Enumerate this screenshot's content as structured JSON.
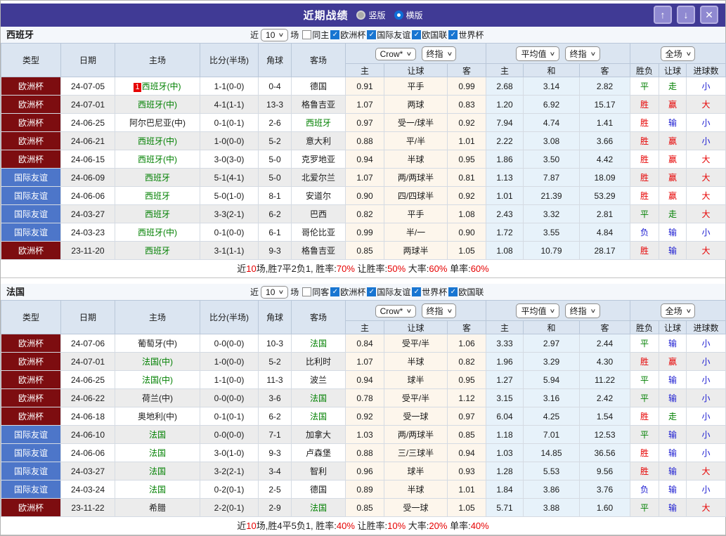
{
  "window": {
    "title": "近期战绩",
    "radios": [
      {
        "label": "竖版",
        "selected": false
      },
      {
        "label": "横版",
        "selected": true
      }
    ],
    "up": "↑",
    "down": "↓",
    "close": "✕"
  },
  "icons": {
    "check": "✓",
    "chevron": "∨"
  },
  "colors": {
    "titlebar": "#403a95",
    "type_cup": "#7d0d10",
    "type_friendly": "#4d76c9",
    "win_red": "#e60000",
    "draw_green": "#008000",
    "lose_blue": "#1b1bd1",
    "handicap_bg": "#fdf6ec",
    "average_bg": "#e7f2fa",
    "header_bg": "#dbe5f1"
  },
  "columns": {
    "left": [
      "类型",
      "日期",
      "主场",
      "比分(半场)",
      "角球",
      "客场"
    ],
    "odds_sub": [
      "主",
      "让球",
      "客"
    ],
    "avg_sub": [
      "主",
      "和",
      "客"
    ],
    "result_sub": [
      "胜负",
      "让球",
      "进球数"
    ]
  },
  "sections": [
    {
      "team": "西班牙",
      "filter": {
        "near": "近",
        "count": "10",
        "unit": "场",
        "same": "同主",
        "leagues": [
          "欧洲杯",
          "国际友谊",
          "欧国联",
          "世界杯"
        ]
      },
      "dropdowns": {
        "odds": "Crow*",
        "odds_time": "终指",
        "avg": "平均值",
        "avg_time": "终指",
        "scope": "全场"
      },
      "rows": [
        {
          "type": "欧洲杯",
          "style": "cup",
          "date": "24-07-05",
          "badge": "1",
          "home": "西班牙(中)",
          "home_hl": true,
          "score": "1-1(0-0)",
          "corner": "0-4",
          "away": "德国",
          "away_hl": false,
          "odds": [
            "0.91",
            "平手",
            "0.99"
          ],
          "avg": [
            "2.68",
            "3.14",
            "2.82"
          ],
          "results": [
            [
              "平",
              "g"
            ],
            [
              "走",
              "g"
            ],
            [
              "小",
              "b"
            ]
          ]
        },
        {
          "type": "欧洲杯",
          "style": "cup",
          "date": "24-07-01",
          "home": "西班牙(中)",
          "home_hl": true,
          "score": "4-1(1-1)",
          "corner": "13-3",
          "away": "格鲁吉亚",
          "away_hl": false,
          "odds": [
            "1.07",
            "两球",
            "0.83"
          ],
          "avg": [
            "1.20",
            "6.92",
            "15.17"
          ],
          "results": [
            [
              "胜",
              "r"
            ],
            [
              "赢",
              "r"
            ],
            [
              "大",
              "r"
            ]
          ]
        },
        {
          "type": "欧洲杯",
          "style": "cup",
          "date": "24-06-25",
          "home": "阿尔巴尼亚(中)",
          "home_hl": false,
          "score": "0-1(0-1)",
          "corner": "2-6",
          "away": "西班牙",
          "away_hl": true,
          "odds": [
            "0.97",
            "受一/球半",
            "0.92"
          ],
          "avg": [
            "7.94",
            "4.74",
            "1.41"
          ],
          "results": [
            [
              "胜",
              "r"
            ],
            [
              "输",
              "b"
            ],
            [
              "小",
              "b"
            ]
          ]
        },
        {
          "type": "欧洲杯",
          "style": "cup",
          "date": "24-06-21",
          "home": "西班牙(中)",
          "home_hl": true,
          "score": "1-0(0-0)",
          "corner": "5-2",
          "away": "意大利",
          "away_hl": false,
          "odds": [
            "0.88",
            "平/半",
            "1.01"
          ],
          "avg": [
            "2.22",
            "3.08",
            "3.66"
          ],
          "results": [
            [
              "胜",
              "r"
            ],
            [
              "赢",
              "r"
            ],
            [
              "小",
              "b"
            ]
          ]
        },
        {
          "type": "欧洲杯",
          "style": "cup",
          "date": "24-06-15",
          "home": "西班牙(中)",
          "home_hl": true,
          "score": "3-0(3-0)",
          "corner": "5-0",
          "away": "克罗地亚",
          "away_hl": false,
          "odds": [
            "0.94",
            "半球",
            "0.95"
          ],
          "avg": [
            "1.86",
            "3.50",
            "4.42"
          ],
          "results": [
            [
              "胜",
              "r"
            ],
            [
              "赢",
              "r"
            ],
            [
              "大",
              "r"
            ]
          ]
        },
        {
          "type": "国际友谊",
          "style": "friendly",
          "date": "24-06-09",
          "home": "西班牙",
          "home_hl": true,
          "score": "5-1(4-1)",
          "corner": "5-0",
          "away": "北爱尔兰",
          "away_hl": false,
          "odds": [
            "1.07",
            "两/两球半",
            "0.81"
          ],
          "avg": [
            "1.13",
            "7.87",
            "18.09"
          ],
          "results": [
            [
              "胜",
              "r"
            ],
            [
              "赢",
              "r"
            ],
            [
              "大",
              "r"
            ]
          ]
        },
        {
          "type": "国际友谊",
          "style": "friendly",
          "date": "24-06-06",
          "home": "西班牙",
          "home_hl": true,
          "score": "5-0(1-0)",
          "corner": "8-1",
          "away": "安道尔",
          "away_hl": false,
          "odds": [
            "0.90",
            "四/四球半",
            "0.92"
          ],
          "avg": [
            "1.01",
            "21.39",
            "53.29"
          ],
          "results": [
            [
              "胜",
              "r"
            ],
            [
              "赢",
              "r"
            ],
            [
              "大",
              "r"
            ]
          ]
        },
        {
          "type": "国际友谊",
          "style": "friendly",
          "date": "24-03-27",
          "home": "西班牙",
          "home_hl": true,
          "score": "3-3(2-1)",
          "corner": "6-2",
          "away": "巴西",
          "away_hl": false,
          "odds": [
            "0.82",
            "平手",
            "1.08"
          ],
          "avg": [
            "2.43",
            "3.32",
            "2.81"
          ],
          "results": [
            [
              "平",
              "g"
            ],
            [
              "走",
              "g"
            ],
            [
              "大",
              "r"
            ]
          ]
        },
        {
          "type": "国际友谊",
          "style": "friendly",
          "date": "24-03-23",
          "home": "西班牙(中)",
          "home_hl": true,
          "score": "0-1(0-0)",
          "corner": "6-1",
          "away": "哥伦比亚",
          "away_hl": false,
          "odds": [
            "0.99",
            "半/一",
            "0.90"
          ],
          "avg": [
            "1.72",
            "3.55",
            "4.84"
          ],
          "results": [
            [
              "负",
              "b"
            ],
            [
              "输",
              "b"
            ],
            [
              "小",
              "b"
            ]
          ]
        },
        {
          "type": "欧洲杯",
          "style": "cup",
          "date": "23-11-20",
          "home": "西班牙",
          "home_hl": true,
          "score": "3-1(1-1)",
          "corner": "9-3",
          "away": "格鲁吉亚",
          "away_hl": false,
          "odds": [
            "0.85",
            "两球半",
            "1.05"
          ],
          "avg": [
            "1.08",
            "10.79",
            "28.17"
          ],
          "results": [
            [
              "胜",
              "r"
            ],
            [
              "输",
              "b"
            ],
            [
              "大",
              "r"
            ]
          ]
        }
      ],
      "summary": [
        {
          "t": "近",
          "red": false
        },
        {
          "t": "10",
          "red": true
        },
        {
          "t": "场,胜7平2负1, 胜率:",
          "red": false
        },
        {
          "t": "70%",
          "red": true
        },
        {
          "t": " 让胜率:",
          "red": false
        },
        {
          "t": "50%",
          "red": true
        },
        {
          "t": " 大率:",
          "red": false
        },
        {
          "t": "60%",
          "red": true
        },
        {
          "t": " 单率:",
          "red": false
        },
        {
          "t": "60%",
          "red": true
        }
      ]
    },
    {
      "team": "法国",
      "filter": {
        "near": "近",
        "count": "10",
        "unit": "场",
        "same": "同客",
        "leagues": [
          "欧洲杯",
          "国际友谊",
          "世界杯",
          "欧国联"
        ]
      },
      "dropdowns": {
        "odds": "Crow*",
        "odds_time": "终指",
        "avg": "平均值",
        "avg_time": "终指",
        "scope": "全场"
      },
      "rows": [
        {
          "type": "欧洲杯",
          "style": "cup",
          "date": "24-07-06",
          "home": "葡萄牙(中)",
          "home_hl": false,
          "score": "0-0(0-0)",
          "corner": "10-3",
          "away": "法国",
          "away_hl": true,
          "odds": [
            "0.84",
            "受平/半",
            "1.06"
          ],
          "avg": [
            "3.33",
            "2.97",
            "2.44"
          ],
          "results": [
            [
              "平",
              "g"
            ],
            [
              "输",
              "b"
            ],
            [
              "小",
              "b"
            ]
          ]
        },
        {
          "type": "欧洲杯",
          "style": "cup",
          "date": "24-07-01",
          "home": "法国(中)",
          "home_hl": true,
          "score": "1-0(0-0)",
          "corner": "5-2",
          "away": "比利时",
          "away_hl": false,
          "odds": [
            "1.07",
            "半球",
            "0.82"
          ],
          "avg": [
            "1.96",
            "3.29",
            "4.30"
          ],
          "results": [
            [
              "胜",
              "r"
            ],
            [
              "赢",
              "r"
            ],
            [
              "小",
              "b"
            ]
          ]
        },
        {
          "type": "欧洲杯",
          "style": "cup",
          "date": "24-06-25",
          "home": "法国(中)",
          "home_hl": true,
          "score": "1-1(0-0)",
          "corner": "11-3",
          "away": "波兰",
          "away_hl": false,
          "odds": [
            "0.94",
            "球半",
            "0.95"
          ],
          "avg": [
            "1.27",
            "5.94",
            "11.22"
          ],
          "results": [
            [
              "平",
              "g"
            ],
            [
              "输",
              "b"
            ],
            [
              "小",
              "b"
            ]
          ]
        },
        {
          "type": "欧洲杯",
          "style": "cup",
          "date": "24-06-22",
          "home": "荷兰(中)",
          "home_hl": false,
          "score": "0-0(0-0)",
          "corner": "3-6",
          "away": "法国",
          "away_hl": true,
          "odds": [
            "0.78",
            "受平/半",
            "1.12"
          ],
          "avg": [
            "3.15",
            "3.16",
            "2.42"
          ],
          "results": [
            [
              "平",
              "g"
            ],
            [
              "输",
              "b"
            ],
            [
              "小",
              "b"
            ]
          ]
        },
        {
          "type": "欧洲杯",
          "style": "cup",
          "date": "24-06-18",
          "home": "奥地利(中)",
          "home_hl": false,
          "score": "0-1(0-1)",
          "corner": "6-2",
          "away": "法国",
          "away_hl": true,
          "odds": [
            "0.92",
            "受一球",
            "0.97"
          ],
          "avg": [
            "6.04",
            "4.25",
            "1.54"
          ],
          "results": [
            [
              "胜",
              "r"
            ],
            [
              "走",
              "g"
            ],
            [
              "小",
              "b"
            ]
          ]
        },
        {
          "type": "国际友谊",
          "style": "friendly",
          "date": "24-06-10",
          "home": "法国",
          "home_hl": true,
          "score": "0-0(0-0)",
          "corner": "7-1",
          "away": "加拿大",
          "away_hl": false,
          "odds": [
            "1.03",
            "两/两球半",
            "0.85"
          ],
          "avg": [
            "1.18",
            "7.01",
            "12.53"
          ],
          "results": [
            [
              "平",
              "g"
            ],
            [
              "输",
              "b"
            ],
            [
              "小",
              "b"
            ]
          ]
        },
        {
          "type": "国际友谊",
          "style": "friendly",
          "date": "24-06-06",
          "home": "法国",
          "home_hl": true,
          "score": "3-0(1-0)",
          "corner": "9-3",
          "away": "卢森堡",
          "away_hl": false,
          "odds": [
            "0.88",
            "三/三球半",
            "0.94"
          ],
          "avg": [
            "1.03",
            "14.85",
            "36.56"
          ],
          "results": [
            [
              "胜",
              "r"
            ],
            [
              "输",
              "b"
            ],
            [
              "小",
              "b"
            ]
          ]
        },
        {
          "type": "国际友谊",
          "style": "friendly",
          "date": "24-03-27",
          "home": "法国",
          "home_hl": true,
          "score": "3-2(2-1)",
          "corner": "3-4",
          "away": "智利",
          "away_hl": false,
          "odds": [
            "0.96",
            "球半",
            "0.93"
          ],
          "avg": [
            "1.28",
            "5.53",
            "9.56"
          ],
          "results": [
            [
              "胜",
              "r"
            ],
            [
              "输",
              "b"
            ],
            [
              "大",
              "r"
            ]
          ]
        },
        {
          "type": "国际友谊",
          "style": "friendly",
          "date": "24-03-24",
          "home": "法国",
          "home_hl": true,
          "score": "0-2(0-1)",
          "corner": "2-5",
          "away": "德国",
          "away_hl": false,
          "odds": [
            "0.89",
            "半球",
            "1.01"
          ],
          "avg": [
            "1.84",
            "3.86",
            "3.76"
          ],
          "results": [
            [
              "负",
              "b"
            ],
            [
              "输",
              "b"
            ],
            [
              "小",
              "b"
            ]
          ]
        },
        {
          "type": "欧洲杯",
          "style": "cup",
          "date": "23-11-22",
          "home": "希腊",
          "home_hl": false,
          "score": "2-2(0-1)",
          "corner": "2-9",
          "away": "法国",
          "away_hl": true,
          "odds": [
            "0.85",
            "受一球",
            "1.05"
          ],
          "avg": [
            "5.71",
            "3.88",
            "1.60"
          ],
          "results": [
            [
              "平",
              "g"
            ],
            [
              "输",
              "b"
            ],
            [
              "大",
              "r"
            ]
          ]
        }
      ],
      "summary": [
        {
          "t": "近",
          "red": false
        },
        {
          "t": "10",
          "red": true
        },
        {
          "t": "场,胜4平5负1, 胜率:",
          "red": false
        },
        {
          "t": "40%",
          "red": true
        },
        {
          "t": " 让胜率:",
          "red": false
        },
        {
          "t": "10%",
          "red": true
        },
        {
          "t": " 大率:",
          "red": false
        },
        {
          "t": "20%",
          "red": true
        },
        {
          "t": " 单率:",
          "red": false
        },
        {
          "t": "40%",
          "red": true
        }
      ]
    }
  ]
}
